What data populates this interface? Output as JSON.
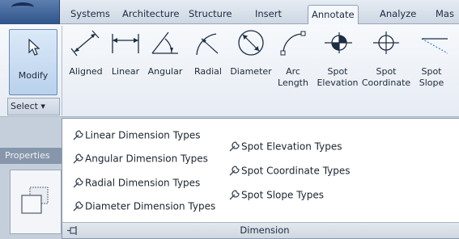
{
  "tabs": [
    {
      "label": "Systems"
    },
    {
      "label": "Architecture"
    },
    {
      "label": "Structure"
    },
    {
      "label": "Insert"
    },
    {
      "label": "Annotate",
      "active": true
    },
    {
      "label": "Analyze"
    },
    {
      "label": "Mas"
    }
  ],
  "modify": {
    "label": "Modify"
  },
  "select": {
    "label": "Select ▾"
  },
  "tools": [
    {
      "label": "Aligned"
    },
    {
      "label": "Linear"
    },
    {
      "label": "Angular"
    },
    {
      "label": "Radial"
    },
    {
      "label": "Diameter"
    },
    {
      "label": "Arc\nLength"
    },
    {
      "label": "Spot\nElevation"
    },
    {
      "label": "Spot\nCoordinate"
    },
    {
      "label": "Spot\nSlope"
    }
  ],
  "properties": {
    "header": "Properties"
  },
  "dropdown": {
    "column_left": [
      {
        "label": "Linear Dimension Types"
      },
      {
        "label": "Angular Dimension Types"
      },
      {
        "label": "Radial Dimension Types"
      },
      {
        "label": "Diameter Dimension Types"
      }
    ],
    "column_right": [
      {
        "label": "Spot Elevation Types"
      },
      {
        "label": "Spot Coordinate Types"
      },
      {
        "label": "Spot Slope Types"
      }
    ],
    "footer_title": "Dimension"
  },
  "colors": {
    "accent": "#3f6fb0",
    "active_tab": "#f4f7fb",
    "ribbon": "#eef2f7"
  }
}
